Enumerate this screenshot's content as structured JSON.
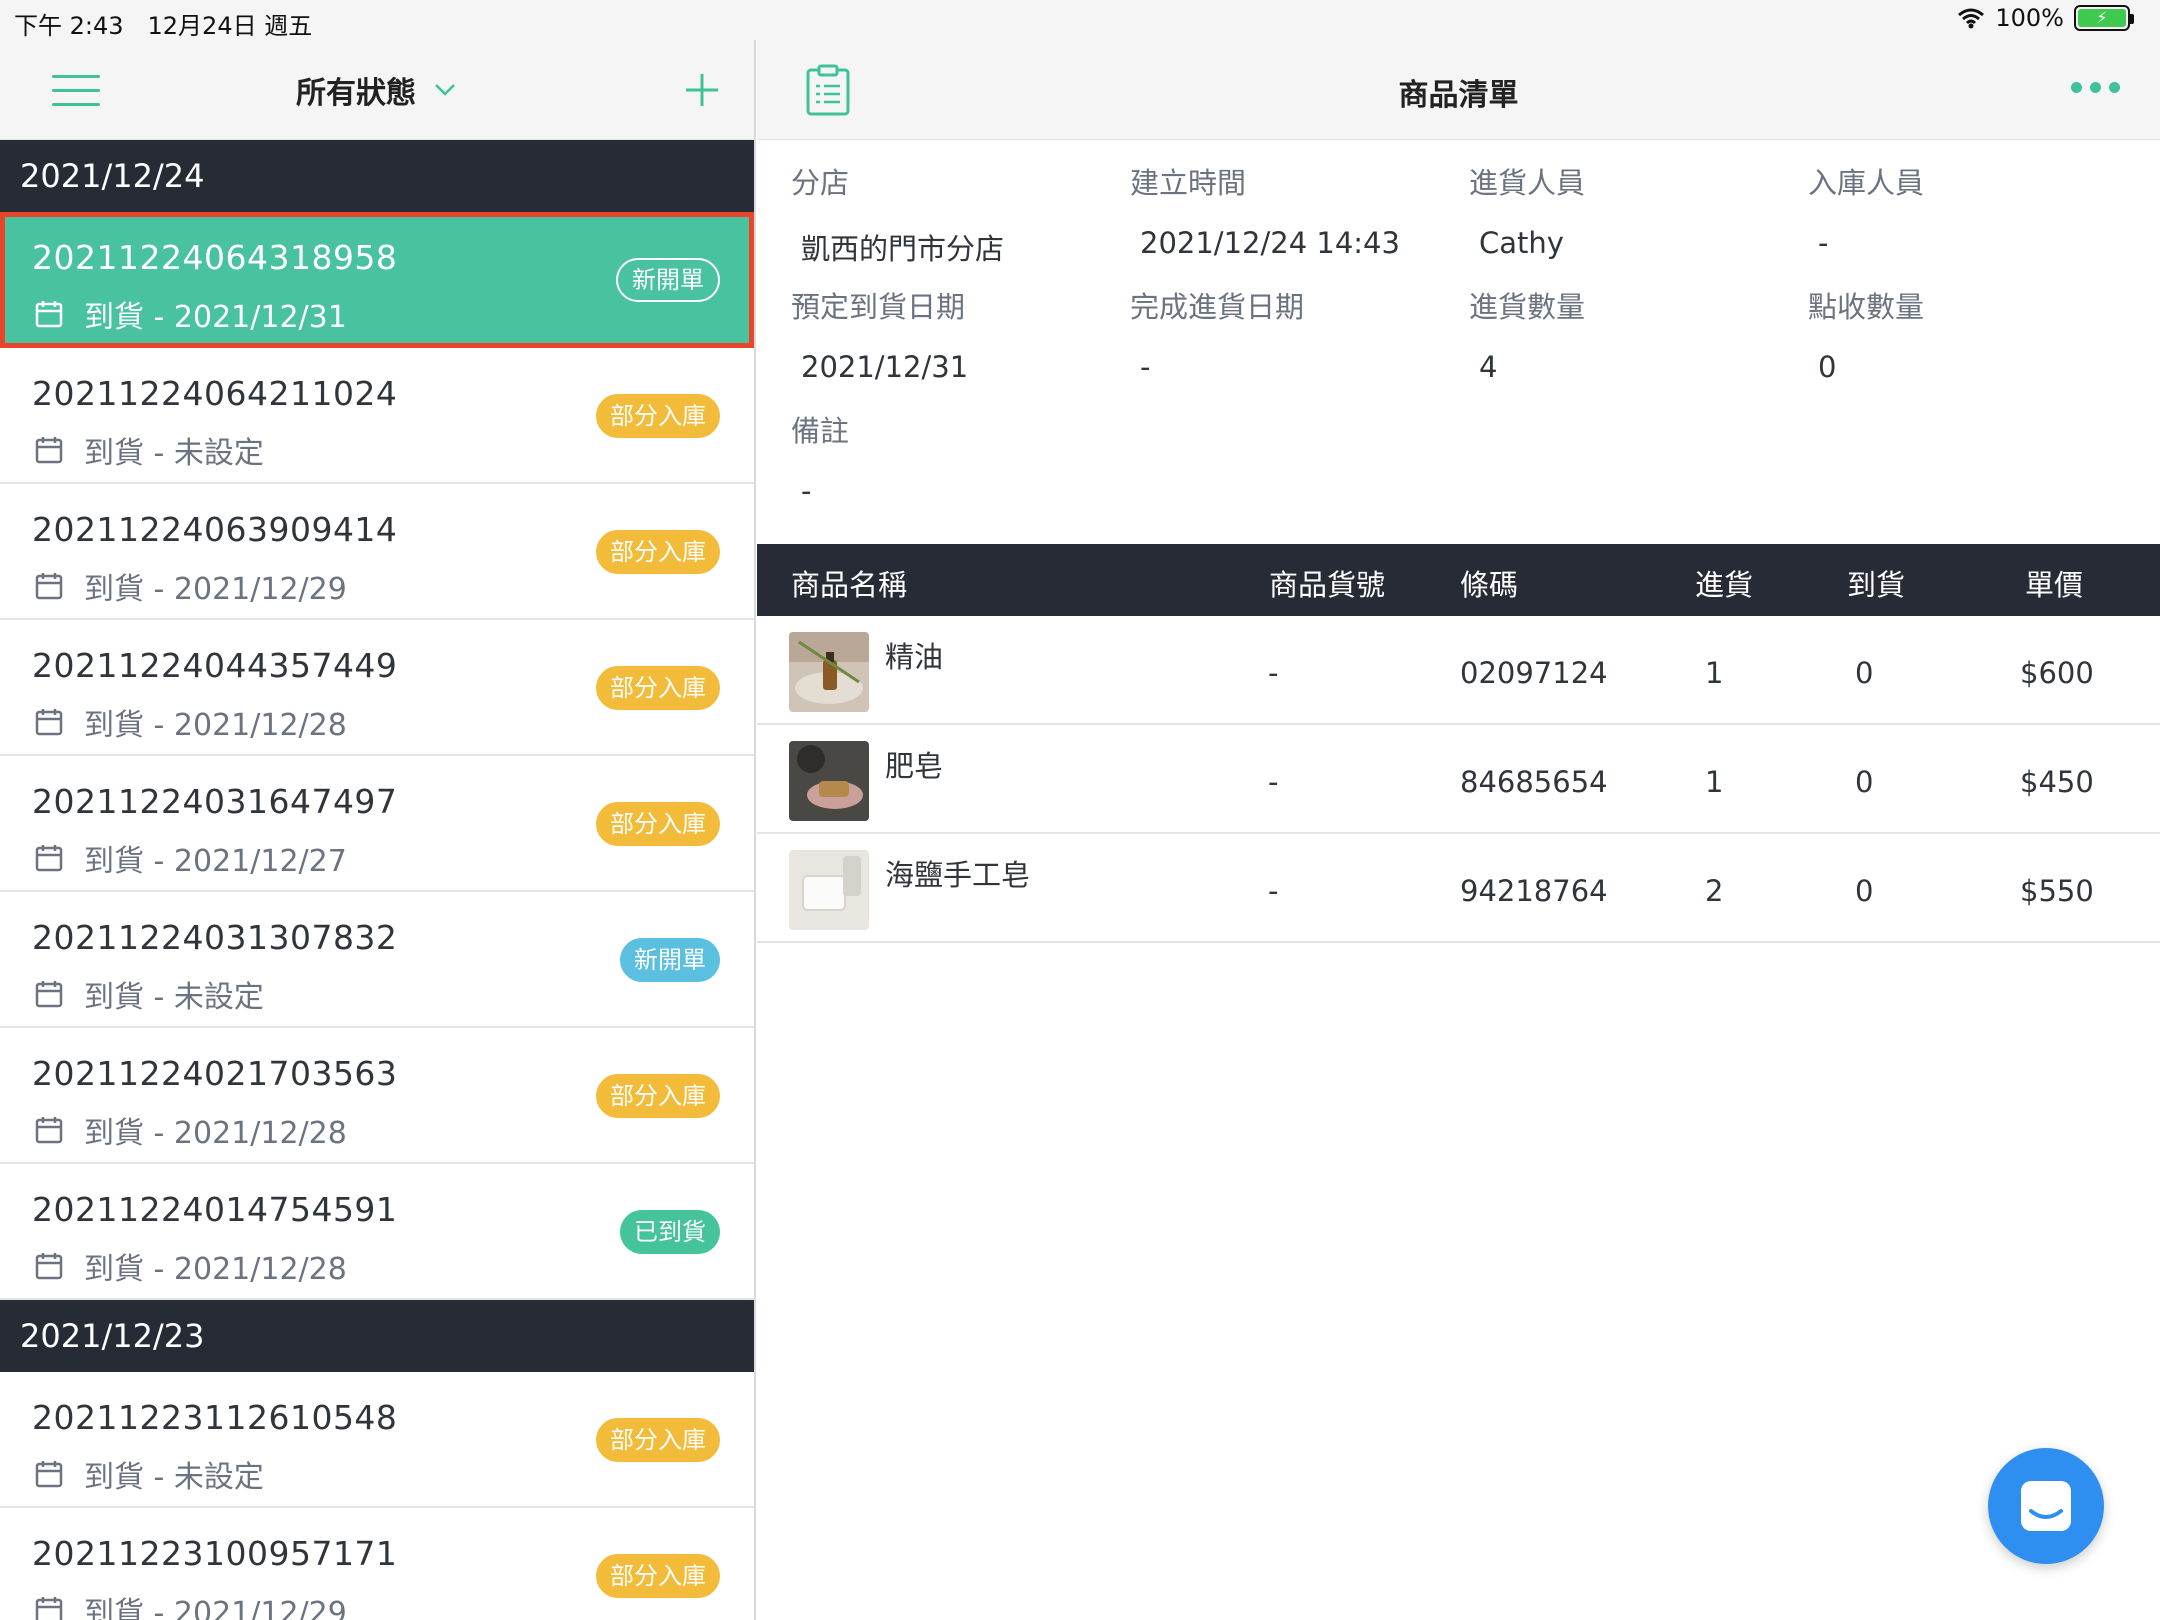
{
  "status_bar": {
    "time_date": "下午 2:43　12月24日 週五",
    "battery_percent": "100%"
  },
  "left_header": {
    "filter_label": "所有狀態"
  },
  "groups": [
    {
      "date": "2021/12/24",
      "orders": [
        {
          "id": "20211224064318958",
          "arrival": "到貨 - 2021/12/31",
          "status": "新開單"
        },
        {
          "id": "20211224064211024",
          "arrival": "到貨 - 未設定",
          "status": "部分入庫"
        },
        {
          "id": "20211224063909414",
          "arrival": "到貨 - 2021/12/29",
          "status": "部分入庫"
        },
        {
          "id": "20211224044357449",
          "arrival": "到貨 - 2021/12/28",
          "status": "部分入庫"
        },
        {
          "id": "20211224031647497",
          "arrival": "到貨 - 2021/12/27",
          "status": "部分入庫"
        },
        {
          "id": "20211224031307832",
          "arrival": "到貨 - 未設定",
          "status": "新開單"
        },
        {
          "id": "20211224021703563",
          "arrival": "到貨 - 2021/12/28",
          "status": "部分入庫"
        },
        {
          "id": "20211224014754591",
          "arrival": "到貨 - 2021/12/28",
          "status": "已到貨"
        }
      ]
    },
    {
      "date": "2021/12/23",
      "orders": [
        {
          "id": "20211223112610548",
          "arrival": "到貨 - 未設定",
          "status": "部分入庫"
        },
        {
          "id": "20211223100957171",
          "arrival": "到貨 - 2021/12/29",
          "status": "部分入庫"
        }
      ]
    }
  ],
  "detail": {
    "title": "商品清單",
    "fields": {
      "branch_label": "分店",
      "branch_value": "凱西的門市分店",
      "created_label": "建立時間",
      "created_value": "2021/12/24 14:43",
      "purchaser_label": "進貨人員",
      "purchaser_value": "Cathy",
      "stocker_label": "入庫人員",
      "stocker_value": "-",
      "expected_label": "預定到貨日期",
      "expected_value": "2021/12/31",
      "completed_label": "完成進貨日期",
      "completed_value": "-",
      "qty_label": "進貨數量",
      "qty_value": "4",
      "checked_label": "點收數量",
      "checked_value": "0",
      "note_label": "備註",
      "note_value": "-"
    },
    "table": {
      "headers": {
        "name": "商品名稱",
        "sku": "商品貨號",
        "barcode": "條碼",
        "incoming": "進貨",
        "arrived": "到貨",
        "price": "單價"
      },
      "rows": [
        {
          "name": "精油",
          "sku": "-",
          "barcode": "02097124",
          "incoming": "1",
          "arrived": "0",
          "price": "$600"
        },
        {
          "name": "肥皂",
          "sku": "-",
          "barcode": "84685654",
          "incoming": "1",
          "arrived": "0",
          "price": "$450"
        },
        {
          "name": "海鹽手工皂",
          "sku": "-",
          "barcode": "94218764",
          "incoming": "2",
          "arrived": "0",
          "price": "$550"
        }
      ]
    }
  },
  "colors": {
    "accent": "#3fc29a",
    "selected_row": "#49c39f",
    "selection_outline": "#e8452a",
    "dark_header": "#262b36",
    "badge_partial": "#f2bb3a",
    "badge_new": "#5bbfe0",
    "badge_arrived": "#45c39b",
    "chat_button": "#2f8ff0"
  }
}
